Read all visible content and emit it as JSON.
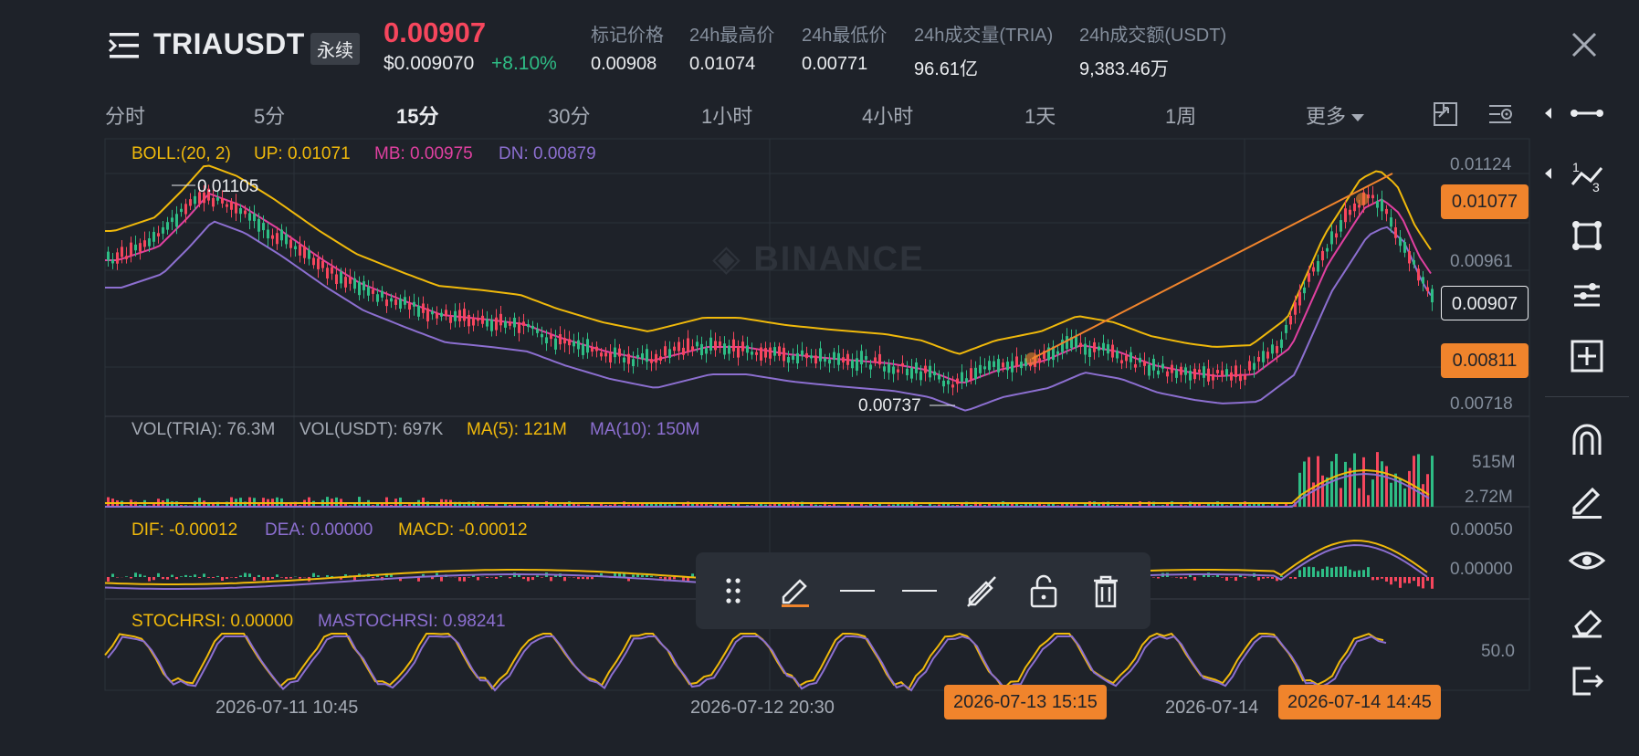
{
  "header": {
    "symbol": "TRIAUSDT",
    "contract_type": "永续",
    "last_price": "0.00907",
    "price_usd": "$0.009070",
    "change_pct": "+8.10%",
    "stats": [
      {
        "label": "标记价格",
        "value": "0.00908"
      },
      {
        "label": "24h最高价",
        "value": "0.01074"
      },
      {
        "label": "24h最低价",
        "value": "0.00771"
      },
      {
        "label": "24h成交量(TRIA)",
        "value": "96.61亿"
      },
      {
        "label": "24h成交额(USDT)",
        "value": "9,383.46万"
      }
    ]
  },
  "tabs": [
    {
      "label": "分时"
    },
    {
      "label": "5分"
    },
    {
      "label": "15分",
      "active": true
    },
    {
      "label": "30分"
    },
    {
      "label": "1小时"
    },
    {
      "label": "4小时"
    },
    {
      "label": "1天"
    },
    {
      "label": "1周"
    },
    {
      "label": "更多"
    }
  ],
  "watermark": "BINANCE",
  "indicators": {
    "boll": {
      "name": "BOLL:(20, 2)",
      "up": "UP: 0.01071",
      "mb": "MB: 0.00975",
      "dn": "DN: 0.00879"
    },
    "vol": {
      "tria": "VOL(TRIA): 76.3M",
      "usdt": "VOL(USDT): 697K",
      "ma5": "MA(5): 121M",
      "ma10": "MA(10): 150M"
    },
    "macd": {
      "dif": "DIF: -0.00012",
      "dea": "DEA: 0.00000",
      "macd": "MACD: -0.00012"
    },
    "stochrsi": {
      "stoch": "STOCHRSI: 0.00000",
      "mastoch": "MASTOCHRSI: 0.98241"
    }
  },
  "price_axis": {
    "ticks": [
      "0.01124",
      "0.00961",
      "0.00718"
    ],
    "tag_upper": "0.01077",
    "tag_current": "0.00907",
    "tag_lower": "0.00811"
  },
  "annotations": {
    "high": "0.01105",
    "low": "0.00737"
  },
  "vol_axis": [
    "515M",
    "2.72M"
  ],
  "macd_axis": [
    "0.00050",
    "0.00000"
  ],
  "stoch_axis": [
    "50.0"
  ],
  "time_axis": [
    "2026-07-11 10:45",
    "2026-07-12 20:30",
    "2026-07-14"
  ],
  "time_tags": [
    "2026-07-13 15:15",
    "2026-07-14 14:45"
  ],
  "colors": {
    "up": "#2ebd85",
    "down": "#f6465d",
    "boll_up": "#f0b90b",
    "boll_mb": "#e040a0",
    "boll_dn": "#8c6fd0",
    "accent": "#f0842c"
  },
  "chart_data": {
    "type": "candlestick",
    "series": [
      {
        "name": "BOLL UP",
        "values": [
          0.01071
        ]
      },
      {
        "name": "BOLL MB",
        "values": [
          0.00975
        ]
      },
      {
        "name": "BOLL DN",
        "values": [
          0.00879
        ]
      }
    ],
    "ylim": [
      0.00718,
      0.01124
    ],
    "price_high_marker": 0.01105,
    "price_low_marker": 0.00737
  }
}
